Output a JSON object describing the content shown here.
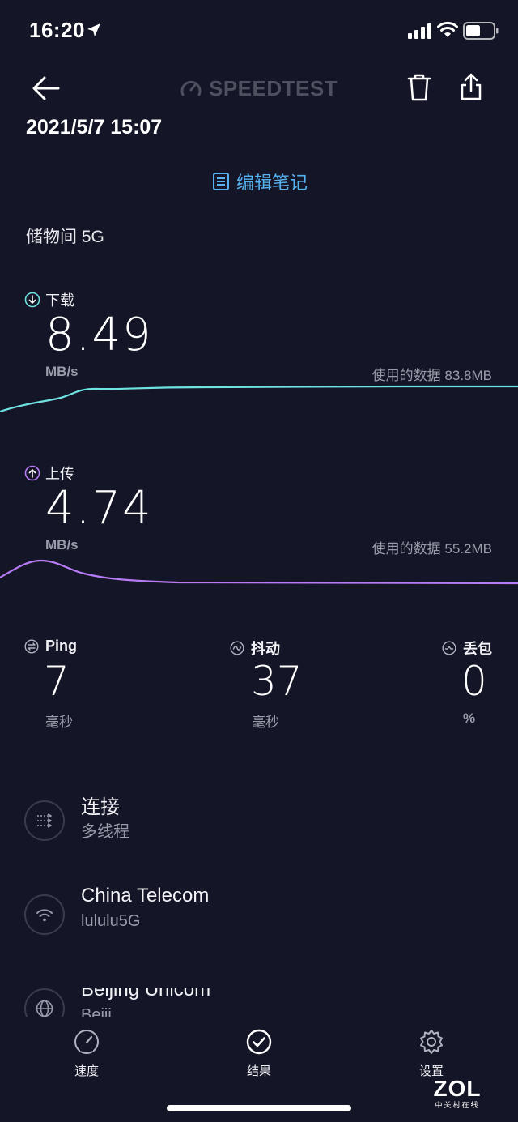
{
  "status_bar": {
    "time": "16:20"
  },
  "header": {
    "logo_text": "SPEEDTEST"
  },
  "result": {
    "datetime": "2021/5/7 15:07",
    "notes_label": "编辑笔记",
    "network_name": "储物间 5G"
  },
  "download": {
    "label": "下载",
    "value": "8.49",
    "unit": "MB/s",
    "data_used": "使用的数据 83.8MB"
  },
  "upload": {
    "label": "上传",
    "value": "4.74",
    "unit": "MB/s",
    "data_used": "使用的数据 55.2MB"
  },
  "stats": {
    "ping": {
      "label": "Ping",
      "value": "7",
      "unit": "毫秒"
    },
    "jitter": {
      "label": "抖动",
      "value": "37",
      "unit": "毫秒"
    },
    "loss": {
      "label": "丢包",
      "value": "0",
      "unit": "%"
    }
  },
  "info": {
    "connection": {
      "title": "连接",
      "sub": "多线程"
    },
    "provider": {
      "title": "China Telecom",
      "sub": "lululu5G"
    },
    "server": {
      "title": "Beijing Unicom",
      "sub": "Beiji..."
    }
  },
  "tabs": [
    {
      "label": "速度"
    },
    {
      "label": "结果"
    },
    {
      "label": "设置"
    }
  ],
  "watermark": {
    "main": "ZOL",
    "sub": "中关村在线"
  },
  "colors": {
    "background": "#141526",
    "download_line": "#6fe3e1",
    "upload_line": "#b77cf5",
    "accent_blue": "#56b2f0",
    "muted_text": "#9a9cab"
  },
  "icons": {
    "status": [
      "location-arrow-icon",
      "cellular-signal-icon",
      "wifi-icon",
      "battery-icon"
    ],
    "header": [
      "back-arrow-icon",
      "speedtest-gauge-icon",
      "trash-icon",
      "share-icon"
    ],
    "tabs": [
      "speed-gauge-icon",
      "checkmark-circle-icon",
      "gear-icon"
    ]
  }
}
